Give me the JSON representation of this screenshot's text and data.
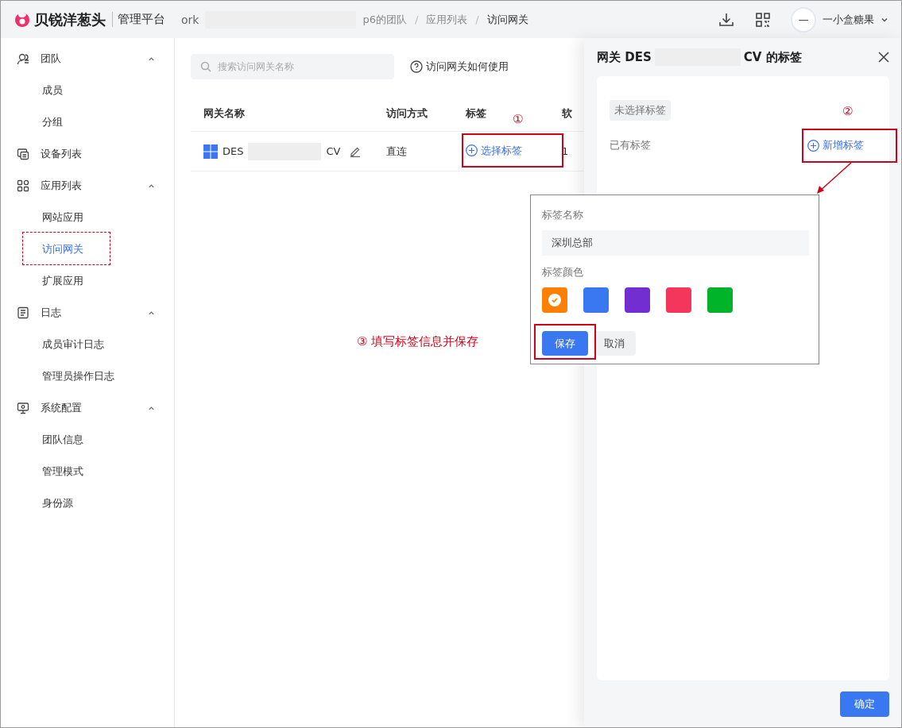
{
  "header": {
    "logo_text": "贝锐洋葱头",
    "product": "管理平台",
    "org": "ork",
    "breadcrumbs": [
      "p6的团队",
      "应用列表",
      "访问网关"
    ],
    "breadcrumb_separator": "/",
    "avatar_text": "—",
    "user": "一小盒糖果"
  },
  "sidebar": {
    "groups": [
      {
        "label": "团队",
        "kind": "team",
        "expanded": true,
        "children": [
          {
            "label": "成员",
            "selected": false
          },
          {
            "label": "分组",
            "selected": false
          }
        ]
      },
      {
        "label": "设备列表",
        "kind": "device"
      },
      {
        "label": "应用列表",
        "kind": "apps",
        "expanded": true,
        "children": [
          {
            "label": "网站应用",
            "selected": false
          },
          {
            "label": "访问网关",
            "selected": true
          },
          {
            "label": "扩展应用",
            "selected": false
          }
        ]
      },
      {
        "label": "日志",
        "kind": "log",
        "expanded": true,
        "children": [
          {
            "label": "成员审计日志",
            "selected": false
          },
          {
            "label": "管理员操作日志",
            "selected": false
          }
        ]
      },
      {
        "label": "系统配置",
        "kind": "config",
        "expanded": true,
        "children": [
          {
            "label": "团队信息",
            "selected": false
          },
          {
            "label": "管理模式",
            "selected": false
          },
          {
            "label": "身份源",
            "selected": false
          }
        ]
      }
    ]
  },
  "main": {
    "search": {
      "placeholder": "搜索访问网关名称"
    },
    "help_link": "访问网关如何使用",
    "table": {
      "columns": [
        "网关名称",
        "访问方式",
        "标签",
        "软"
      ],
      "rows": [
        {
          "name_start": "DES",
          "name_end": "CV",
          "access": "直连",
          "tag_action": "选择标签",
          "column_4": "1"
        }
      ]
    }
  },
  "drawer": {
    "title_start": "网关 DES",
    "title_end": "CV 的标签",
    "empty_tag": "未选择标签",
    "existing_label": "已有标签",
    "add_button": "新增标签",
    "confirm": "确定"
  },
  "popover": {
    "name_label": "标签名称",
    "name_value": "深圳总部",
    "color_label": "标签颜色",
    "colors": [
      {
        "color": "#ff8000",
        "selected": true
      },
      {
        "color": "#3a78f2",
        "selected": false
      },
      {
        "color": "#722ed1",
        "selected": false
      },
      {
        "color": "#f5365c",
        "selected": false
      },
      {
        "color": "#00b42a",
        "selected": false
      }
    ],
    "save": "保存",
    "cancel": "取消"
  },
  "annotations": [
    {
      "text": "①"
    },
    {
      "text": "②"
    },
    {
      "text": "③  填写标签信息并保存"
    }
  ]
}
